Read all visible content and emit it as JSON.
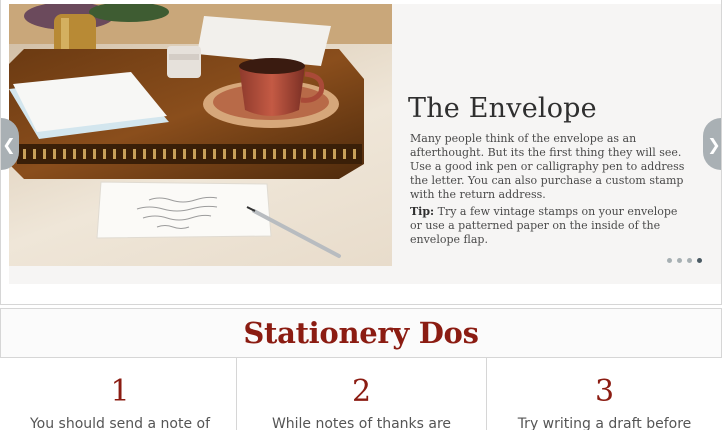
{
  "slider": {
    "prev_icon": "chevron-left-icon",
    "next_icon": "chevron-right-icon",
    "image_alt_icon": "stationery-photo",
    "title": "The Envelope",
    "body": "Many people think of the envelope as an afterthought. But its the first thing they will see. Use a good ink pen or calligraphy pen to address the letter. You can also purchase a custom stamp with the return address.",
    "tip_label": "Tip:",
    "tip_text": " Try a few vintage stamps on your envelope or use a patterned paper on the inside of the envelope flap.",
    "slide_count": 4,
    "active_slide": 4
  },
  "section": {
    "title": "Stationery Dos"
  },
  "columns": [
    {
      "number": "1",
      "text": "You should send a note of"
    },
    {
      "number": "2",
      "text": "While notes of thanks are"
    },
    {
      "number": "3",
      "text": "Try writing a draft before"
    }
  ],
  "colors": {
    "accent": "#8b1c12",
    "arrow": "#a9b0b4",
    "dot_active": "#4a5a63",
    "dot_inactive": "#a7b0b3"
  }
}
